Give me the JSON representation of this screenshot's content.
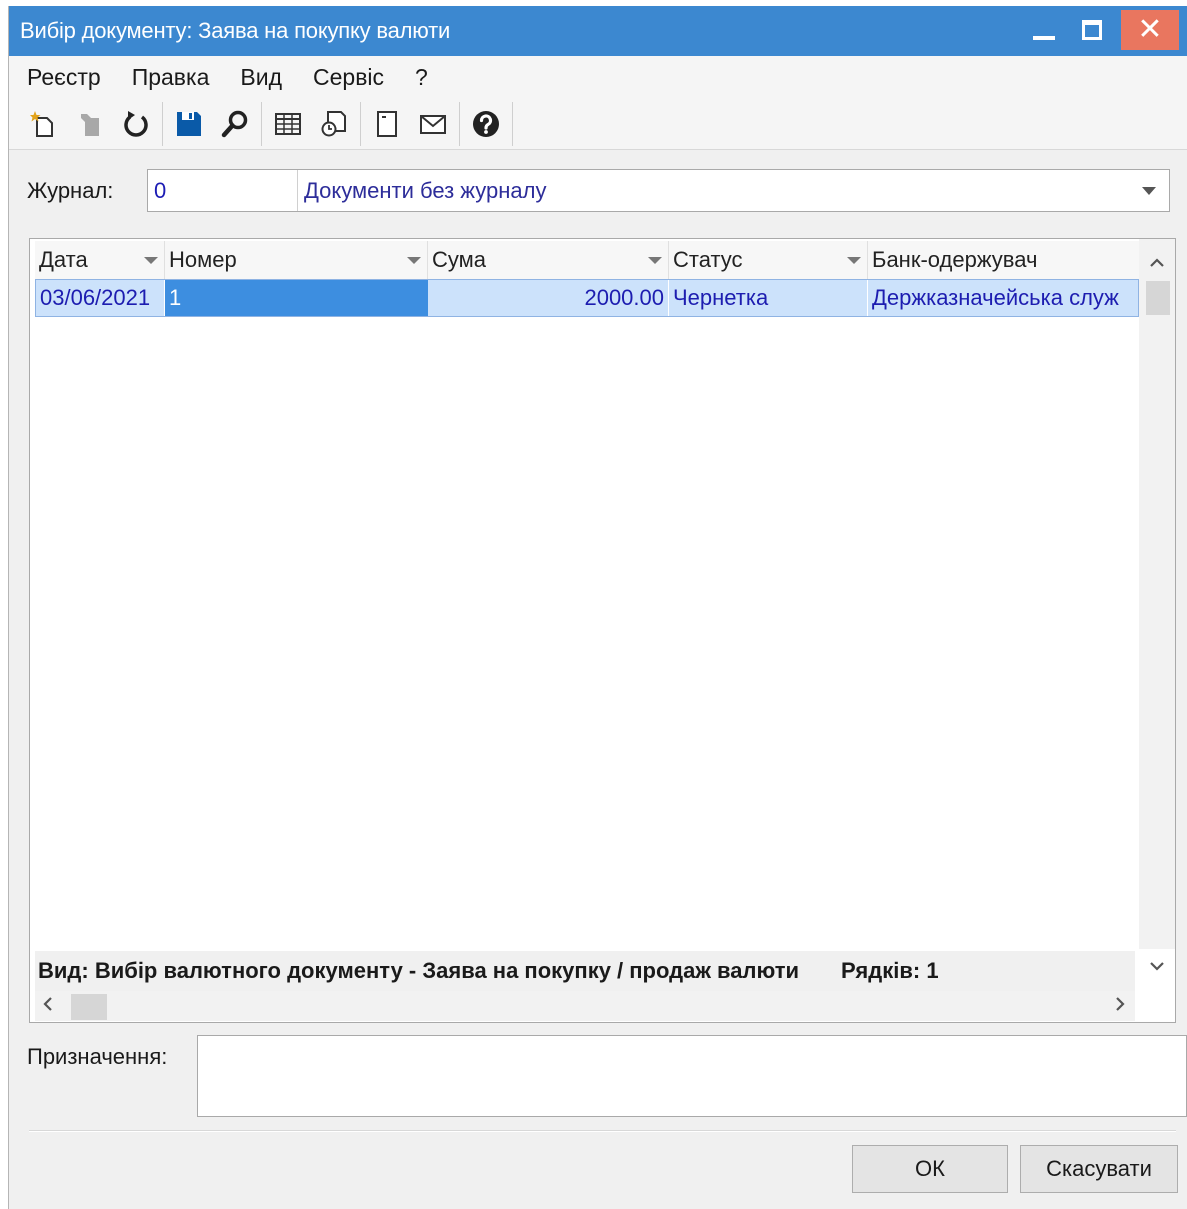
{
  "window": {
    "title": "Вибір документу: Заява на покупку валюти",
    "close_glyph": "✕"
  },
  "menu": [
    "Реєстр",
    "Правка",
    "Вид",
    "Сервіс",
    "?"
  ],
  "toolbar": {
    "icons": [
      "new-document-icon",
      "delete-icon",
      "refresh-icon",
      "save-icon",
      "find-icon",
      "table-icon",
      "copy-icon",
      "bookmark-icon",
      "email-icon",
      "help-icon"
    ]
  },
  "journal": {
    "label": "Журнал:",
    "code": "0",
    "name": "Документи без журналу"
  },
  "grid": {
    "columns": [
      "Дата",
      "Номер",
      "Сума",
      "Статус",
      "Банк-одержувач"
    ],
    "rows": [
      {
        "date": "03/06/2021",
        "number": "1",
        "amount": "2000.00",
        "status": "Чернетка",
        "bank": "Держказначейська служ"
      }
    ],
    "footer_view": "Вид: Вибір валютного документу - Заява на покупку / продаж валюти",
    "footer_rows": "Рядків: 1"
  },
  "purpose": {
    "label": "Призначення:",
    "value": ""
  },
  "buttons": {
    "ok": "ОК",
    "cancel": "Скасувати"
  },
  "colors": {
    "titlebar": "#3c88d0",
    "close": "#e9765f",
    "selection": "#3d8ee0",
    "row_highlight": "#cce2fb",
    "link_text": "#1d1db0"
  }
}
